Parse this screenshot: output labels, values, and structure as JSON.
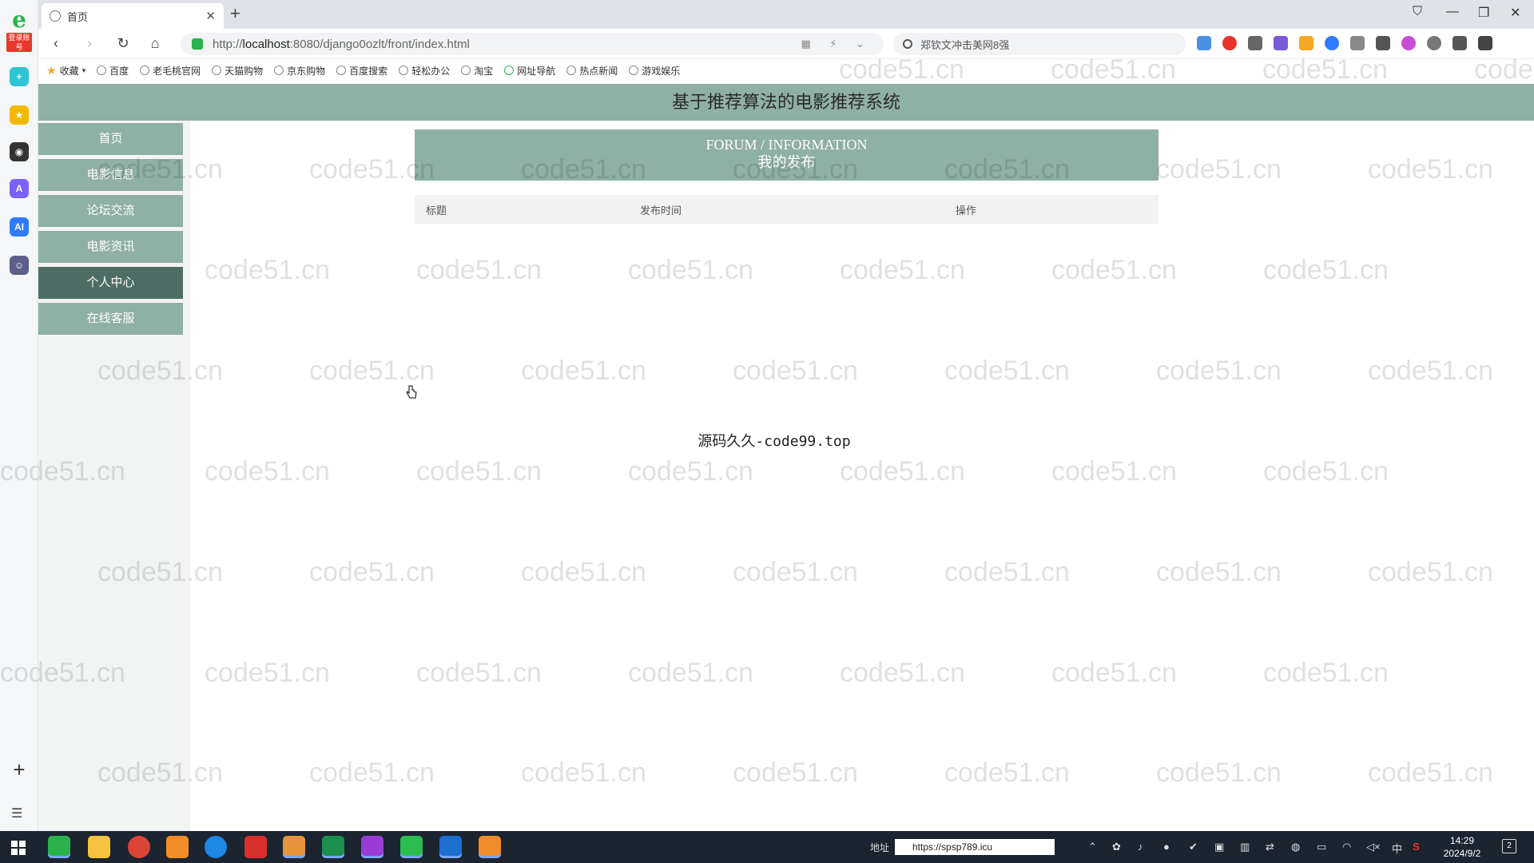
{
  "browser": {
    "rail_badge": "登录账号",
    "tab_title": "首页",
    "url_prefix": "http://",
    "url_host": "localhost",
    "url_rest": ":8080/django0ozlt/front/index.html",
    "search_placeholder": "郑钦文冲击美网8强",
    "bookmarks": [
      {
        "label": "收藏"
      },
      {
        "label": "百度"
      },
      {
        "label": "老毛桃官网"
      },
      {
        "label": "天猫购物"
      },
      {
        "label": "京东购物"
      },
      {
        "label": "百度搜索"
      },
      {
        "label": "轻松办公"
      },
      {
        "label": "淘宝"
      },
      {
        "label": "网址导航"
      },
      {
        "label": "热点新闻"
      },
      {
        "label": "游戏娱乐"
      }
    ]
  },
  "site": {
    "header_title": "基于推荐算法的电影推荐系统",
    "nav": [
      {
        "label": "首页",
        "active": false
      },
      {
        "label": "电影信息",
        "active": false
      },
      {
        "label": "论坛交流",
        "active": false
      },
      {
        "label": "电影资讯",
        "active": false
      },
      {
        "label": "个人中心",
        "active": true
      },
      {
        "label": "在线客服",
        "active": false
      }
    ],
    "banner_en": "FORUM / INFORMATION",
    "banner_cn": "我的发布",
    "table_headers": [
      "标题",
      "发布时间",
      "操作"
    ],
    "footer_text": "源码久久-code99.top",
    "watermark_text": "code51.cn"
  },
  "taskbar": {
    "address_label": "地址",
    "address_value": "https://spsp789.icu",
    "ime": "中",
    "time": "14:29",
    "date": "2024/9/2",
    "notification_count": "2"
  },
  "colors": {
    "accent": "#8fb0a4",
    "nav_active": "#4e6e65",
    "taskbar": "#1c2430"
  }
}
